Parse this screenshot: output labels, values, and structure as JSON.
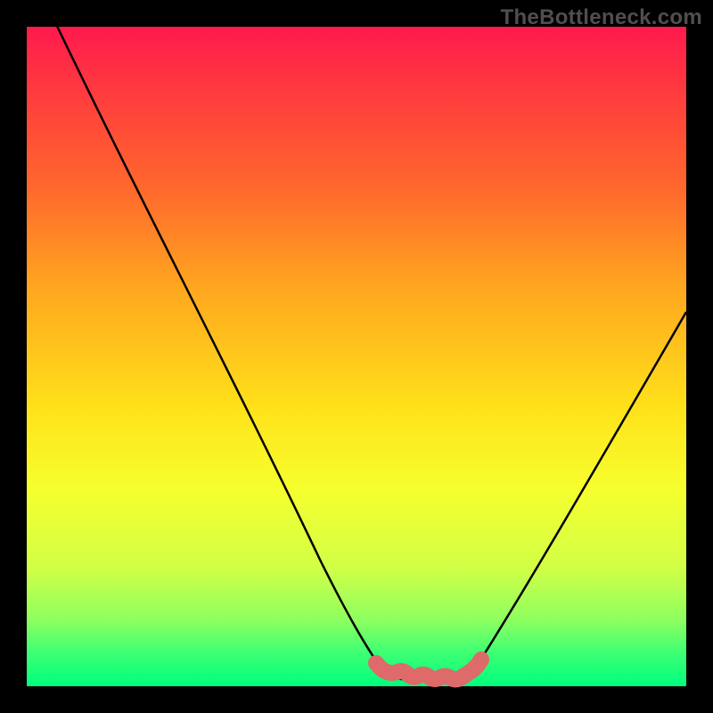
{
  "watermark": "TheBottleneck.com",
  "chart_data": {
    "type": "line",
    "title": "",
    "xlabel": "",
    "ylabel": "",
    "xlim": [
      0,
      100
    ],
    "ylim": [
      0,
      100
    ],
    "gradient_meaning": "bottleneck severity (red high, green low)",
    "series": [
      {
        "name": "bottleneck-curve",
        "color": "#000000",
        "x": [
          0,
          10,
          20,
          30,
          40,
          47,
          52,
          55,
          60,
          65,
          70,
          80,
          90,
          100
        ],
        "y": [
          100,
          83,
          66,
          48,
          31,
          15,
          5,
          2,
          2,
          3,
          8,
          22,
          38,
          56
        ]
      },
      {
        "name": "optimal-band",
        "color": "#de6a6a",
        "x": [
          52,
          55,
          58,
          61,
          64,
          67
        ],
        "y": [
          3,
          2,
          2,
          2,
          2,
          4
        ]
      }
    ],
    "annotations": []
  }
}
